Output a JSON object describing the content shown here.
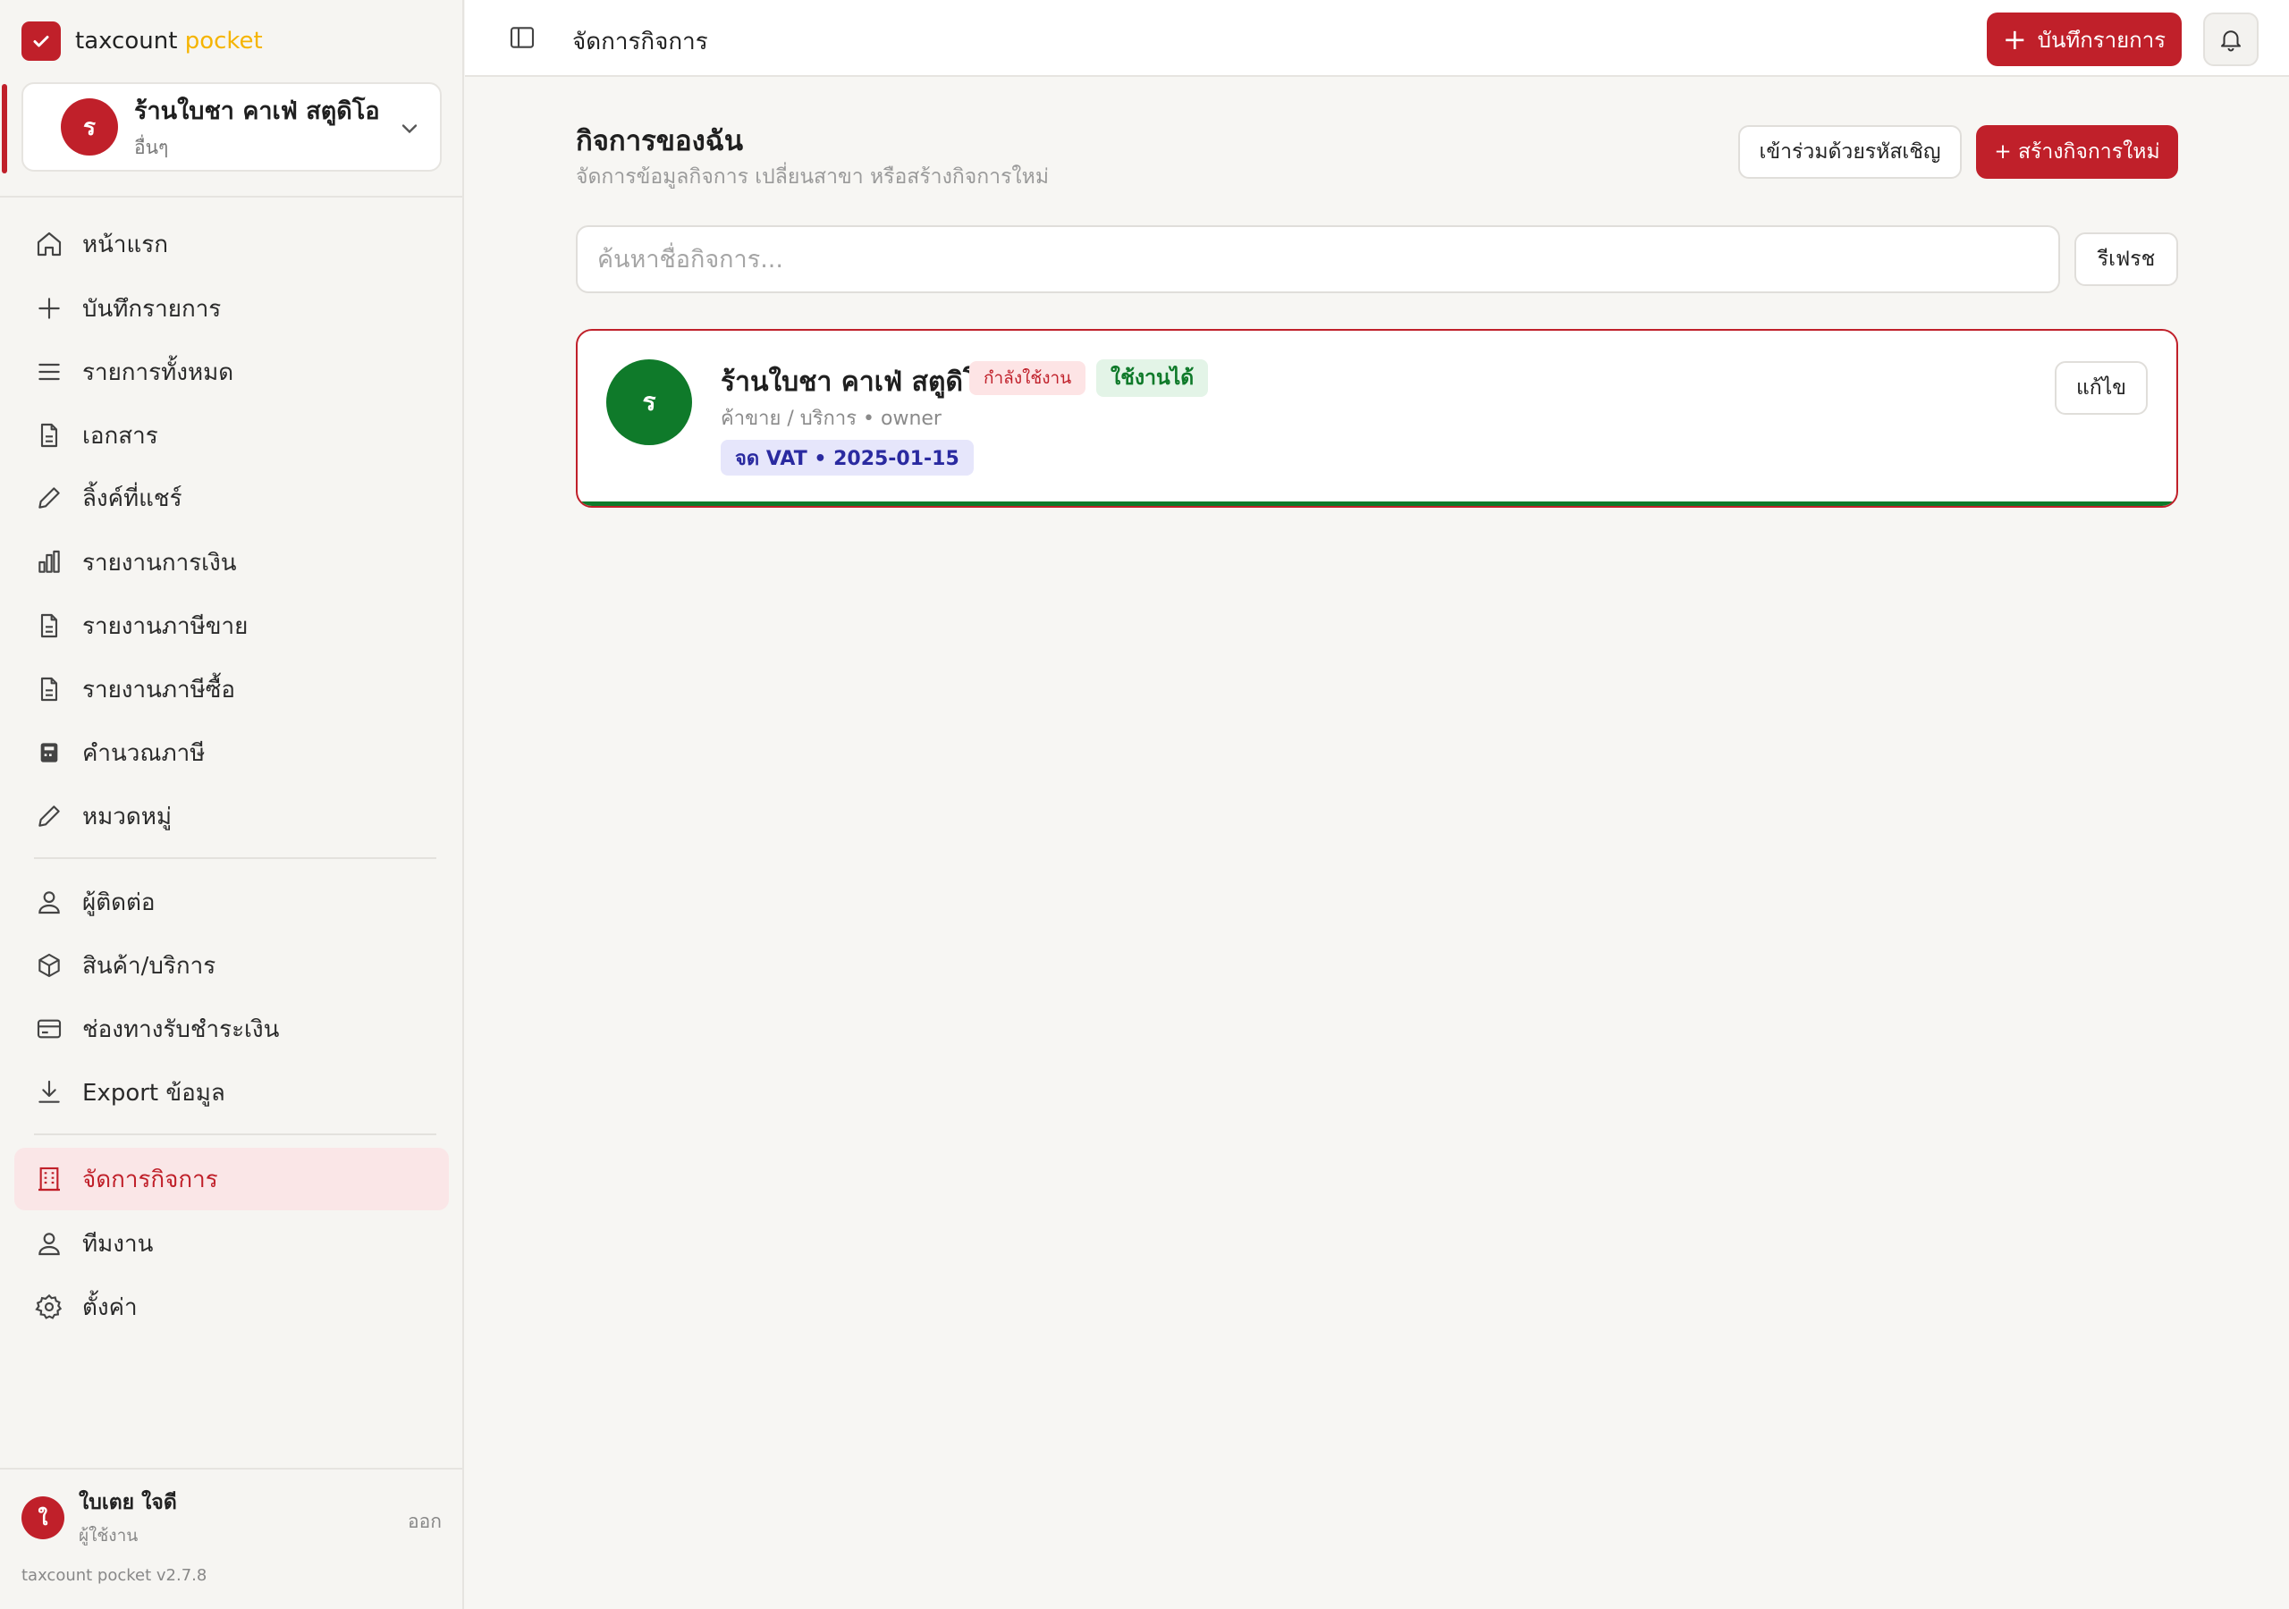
{
  "brand": {
    "name": "taxcount",
    "accent": "pocket",
    "accent_color": "#f5b400",
    "primary_color": "#c0202a"
  },
  "business_switcher": {
    "avatar_letter": "ร",
    "name": "ร้านใบชา คาเฟ่ สตูดิโอ",
    "type": "อื่นๆ"
  },
  "nav": {
    "items": [
      {
        "label": "หน้าแรก",
        "icon": "home-icon"
      },
      {
        "label": "บันทึกรายการ",
        "icon": "plus-icon"
      },
      {
        "label": "รายการทั้งหมด",
        "icon": "list-icon"
      },
      {
        "label": "เอกสาร",
        "icon": "document-icon"
      },
      {
        "label": "ลิ้งค์ที่แชร์",
        "icon": "pencil-icon"
      },
      {
        "label": "รายงานการเงิน",
        "icon": "bar-chart-icon"
      },
      {
        "label": "รายงานภาษีขาย",
        "icon": "document-icon"
      },
      {
        "label": "รายงานภาษีซื้อ",
        "icon": "document-icon"
      },
      {
        "label": "คำนวณภาษี",
        "icon": "calculator-icon"
      },
      {
        "label": "หมวดหมู่",
        "icon": "pencil-icon"
      },
      {
        "label": "ผู้ติดต่อ",
        "icon": "user-icon"
      },
      {
        "label": "สินค้า/บริการ",
        "icon": "box-icon"
      },
      {
        "label": "ช่องทางรับชำระเงิน",
        "icon": "credit-card-icon"
      },
      {
        "label": "Export ข้อมูล",
        "icon": "download-icon"
      },
      {
        "label": "จัดการกิจการ",
        "icon": "building-icon",
        "active": true
      },
      {
        "label": "ทีมงาน",
        "icon": "user-icon"
      },
      {
        "label": "ตั้งค่า",
        "icon": "gear-icon"
      }
    ]
  },
  "user": {
    "avatar_letter": "ใ",
    "name": "ใบเตย ใจดี",
    "role": "ผู้ใช้งาน",
    "logout_label": "ออก"
  },
  "version": "taxcount pocket v2.7.8",
  "topbar": {
    "title": "จัดการกิจการ",
    "record_button": "บันทึกรายการ"
  },
  "main": {
    "title": "กิจการของฉัน",
    "subtitle": "จัดการข้อมูลกิจการ เปลี่ยนสาขา หรือสร้างกิจการใหม่",
    "join_button": "เข้าร่วมด้วยรหัสเชิญ",
    "create_button": "+ สร้างกิจการใหม่",
    "search_placeholder": "ค้นหาชื่อกิจการ...",
    "refresh_button": "รีเฟรช",
    "businesses": [
      {
        "avatar_letter": "ร",
        "avatar_color": "#0f7a2a",
        "name": "ร้านใบชา คาเฟ่ สตูดิโอ",
        "badge_current": "กำลังใช้งาน",
        "badge_status": "ใช้งานได้",
        "meta": "ค้าขาย / บริการ • owner",
        "vat_badge": "จด VAT • 2025-01-15",
        "edit_button": "แก้ไข"
      }
    ]
  }
}
